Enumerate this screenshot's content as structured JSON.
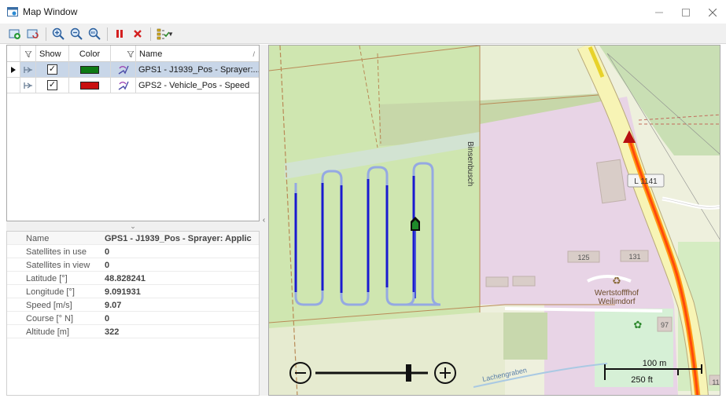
{
  "window": {
    "title": "Map Window",
    "buttons": [
      "minimize",
      "maximize",
      "close"
    ]
  },
  "toolbar": {
    "icons": [
      "add-layer-icon",
      "refresh-layer-icon",
      "zoom-in-icon",
      "zoom-out-icon",
      "zoom-100-icon",
      "pause-icon",
      "delete-icon",
      "checklist-icon"
    ]
  },
  "grid": {
    "columns": [
      "Show",
      "Color",
      "Name"
    ],
    "rows": [
      {
        "show": true,
        "color": "#0f7a14",
        "name": "GPS1 - J1939_Pos - Sprayer:...",
        "selected": true
      },
      {
        "show": true,
        "color": "#c81010",
        "name": "GPS2 - Vehicle_Pos - Speed",
        "selected": false
      }
    ]
  },
  "properties": [
    {
      "key": "Name",
      "value": "GPS1 - J1939_Pos - Sprayer: Applic"
    },
    {
      "key": "Satellites in use",
      "value": "0"
    },
    {
      "key": "Satellites in view",
      "value": "0"
    },
    {
      "key": "Latitude [°]",
      "value": "48.828241"
    },
    {
      "key": "Longitude [°]",
      "value": "9.091931"
    },
    {
      "key": "Speed [m/s]",
      "value": "9.07"
    },
    {
      "key": "Course [° N]",
      "value": "0"
    },
    {
      "key": "Altitude [m]",
      "value": "322"
    }
  ],
  "map": {
    "labels": {
      "street_binsenbusch": "Binsenbusch",
      "road_l1141": "L 1141",
      "house_125": "125",
      "house_131": "131",
      "house_97": "97",
      "house_11": "11",
      "poi_line1": "Wertstofffhof",
      "poi_line2": "Weilimdorf",
      "waterway": "Lachengraben"
    },
    "scale": {
      "metric": "100 m",
      "imperial": "250 ft"
    },
    "colors": {
      "track_gps1": "#1a1ad0",
      "track_gps2": "#e23020",
      "marker_gps1": "#117a1a",
      "marker_gps2": "#b81010"
    }
  }
}
